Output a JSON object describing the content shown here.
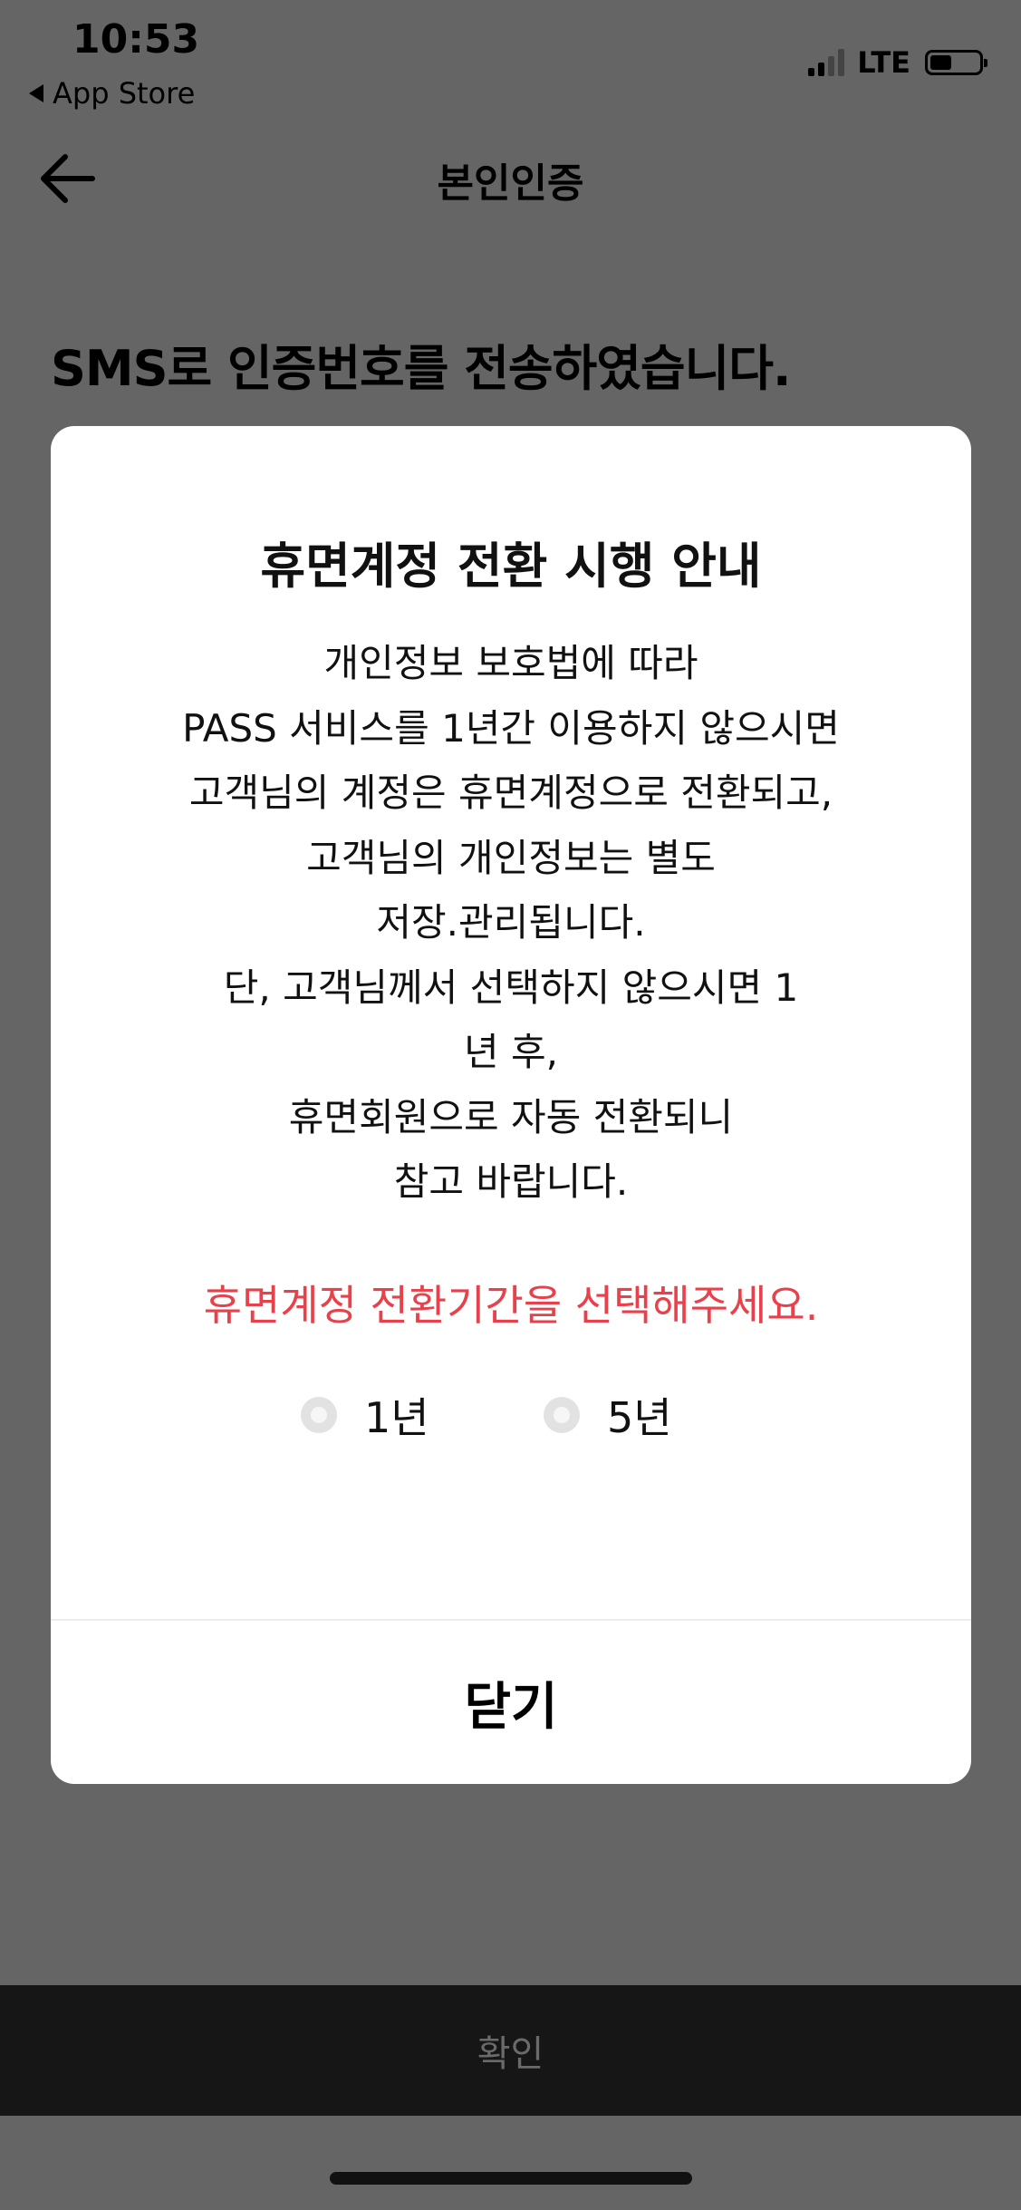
{
  "status_bar": {
    "time": "10:53",
    "back_app": "App Store",
    "network": "LTE"
  },
  "header": {
    "title": "본인인증",
    "back_icon": "arrow-left-icon"
  },
  "main": {
    "sms_message": "SMS로 인증번호를 전송하였습니다."
  },
  "modal": {
    "title": "휴면계정 전환 시행 안내",
    "body_lines": [
      "개인정보 보호법에 따라",
      "PASS 서비스를 1년간 이용하지 않으시면",
      "고객님의 계정은 휴면계정으로 전환되고,",
      "고객님의 개인정보는 별도",
      "저장.관리됩니다.",
      "단, 고객님께서 선택하지 않으시면 1",
      "년 후,",
      "휴면회원으로 자동 전환되니",
      "참고 바랍니다."
    ],
    "notice": "휴면계정 전환기간을 선택해주세요.",
    "notice_color": "#e8414b",
    "options": [
      {
        "label": "1년",
        "selected": false
      },
      {
        "label": "5년",
        "selected": false
      }
    ],
    "close_label": "닫기"
  },
  "bottom": {
    "confirm_label": "확인"
  }
}
